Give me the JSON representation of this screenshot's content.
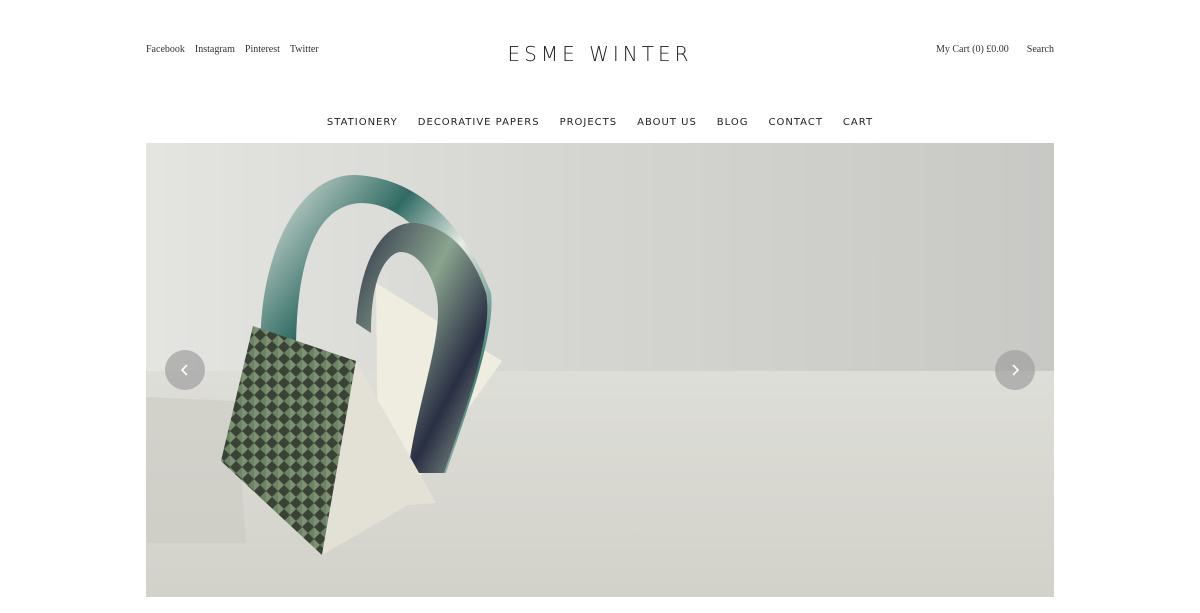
{
  "social": [
    "Facebook",
    "Instagram",
    "Pinterest",
    "Twitter"
  ],
  "brand": "ESME WINTER",
  "utility": {
    "cart": "My Cart (0) £0.00",
    "search": "Search"
  },
  "nav": [
    "STATIONERY",
    "DECORATIVE PAPERS",
    "PROJECTS",
    "ABOUT US",
    "BLOG",
    "CONTACT",
    "CART"
  ],
  "hero": {
    "prev_icon": "chevron-left-icon",
    "next_icon": "chevron-right-icon"
  }
}
